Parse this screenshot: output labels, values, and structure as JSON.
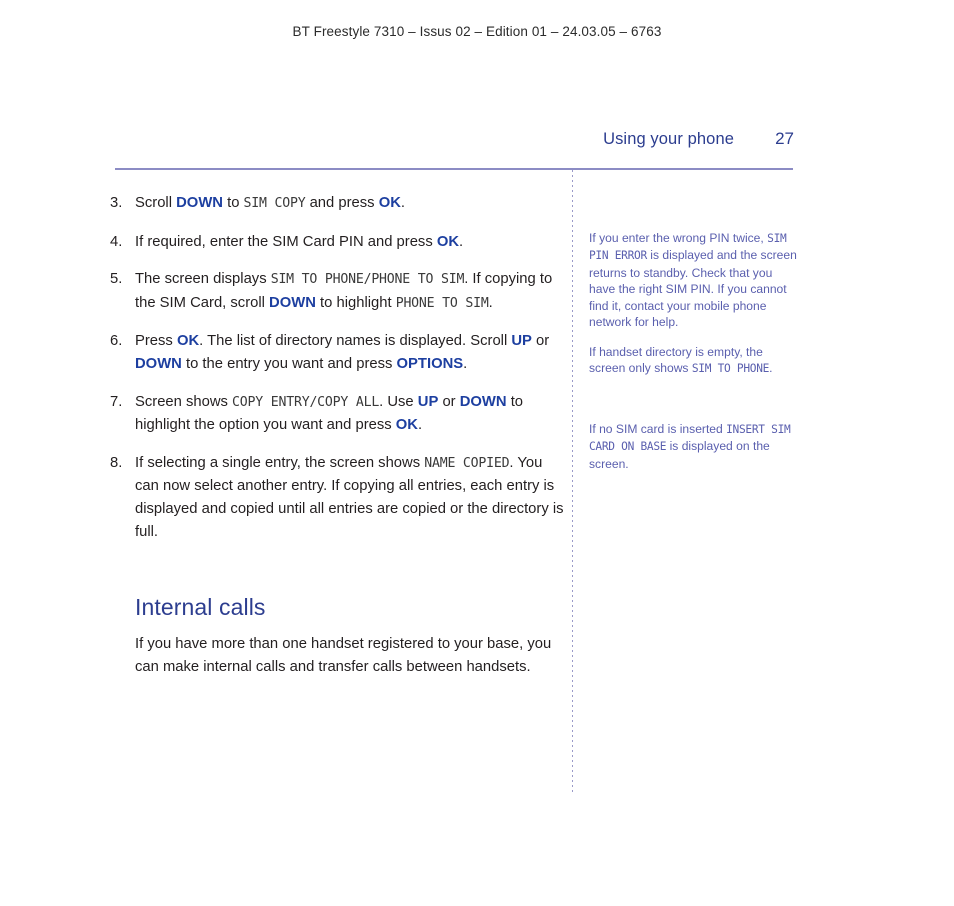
{
  "document_header": "BT Freestyle 7310 – Issus 02 – Edition 01 – 24.03.05 – 6763",
  "page_header": {
    "section_title": "Using your phone",
    "page_number": "27"
  },
  "steps": [
    {
      "number": "3.",
      "parts": [
        {
          "t": "Scroll ",
          "s": "plain"
        },
        {
          "t": "DOWN",
          "s": "kw"
        },
        {
          "t": " to ",
          "s": "plain"
        },
        {
          "t": "SIM COPY",
          "s": "lcd"
        },
        {
          "t": " and press ",
          "s": "plain"
        },
        {
          "t": "OK",
          "s": "kw"
        },
        {
          "t": ".",
          "s": "plain"
        }
      ]
    },
    {
      "number": "4.",
      "parts": [
        {
          "t": "If required, enter the SIM Card PIN and press ",
          "s": "plain"
        },
        {
          "t": "OK",
          "s": "kw"
        },
        {
          "t": ".",
          "s": "plain"
        }
      ]
    },
    {
      "number": "5.",
      "parts": [
        {
          "t": "The screen displays ",
          "s": "plain"
        },
        {
          "t": "SIM TO PHONE/PHONE TO SIM",
          "s": "lcd"
        },
        {
          "t": ". If copying to the SIM Card, scroll ",
          "s": "plain"
        },
        {
          "t": "DOWN",
          "s": "kw"
        },
        {
          "t": " to highlight ",
          "s": "plain"
        },
        {
          "t": "PHONE TO SIM",
          "s": "lcd"
        },
        {
          "t": ".",
          "s": "plain"
        }
      ]
    },
    {
      "number": "6.",
      "parts": [
        {
          "t": "Press ",
          "s": "plain"
        },
        {
          "t": "OK",
          "s": "kw"
        },
        {
          "t": ". The list of directory names is displayed. Scroll ",
          "s": "plain"
        },
        {
          "t": "UP",
          "s": "kw"
        },
        {
          "t": " or ",
          "s": "plain"
        },
        {
          "t": "DOWN",
          "s": "kw"
        },
        {
          "t": " to the entry you want and press ",
          "s": "plain"
        },
        {
          "t": "OPTIONS",
          "s": "kw"
        },
        {
          "t": ".",
          "s": "plain"
        }
      ]
    },
    {
      "number": "7.",
      "parts": [
        {
          "t": "Screen shows ",
          "s": "plain"
        },
        {
          "t": "COPY ENTRY/COPY ALL",
          "s": "lcd"
        },
        {
          "t": ". Use ",
          "s": "plain"
        },
        {
          "t": "UP",
          "s": "kw"
        },
        {
          "t": " or ",
          "s": "plain"
        },
        {
          "t": "DOWN",
          "s": "kw"
        },
        {
          "t": " to highlight the option you want and press ",
          "s": "plain"
        },
        {
          "t": "OK",
          "s": "kw"
        },
        {
          "t": ".",
          "s": "plain"
        }
      ]
    },
    {
      "number": "8.",
      "parts": [
        {
          "t": "If selecting a single entry, the screen shows ",
          "s": "plain"
        },
        {
          "t": "NAME COPIED",
          "s": "lcd"
        },
        {
          "t": ". You can now select another entry. If copying all entries, each entry is displayed and copied until all entries are copied or the directory is full.",
          "s": "plain"
        }
      ]
    }
  ],
  "subsection": {
    "heading": "Internal calls",
    "body": "If you have more than one handset registered to your base, you can make internal calls and transfer calls between handsets."
  },
  "side_notes": [
    {
      "parts": [
        {
          "t": "If you enter the wrong PIN twice, ",
          "s": "plain"
        },
        {
          "t": "SIM PIN ERROR",
          "s": "lcd"
        },
        {
          "t": " is displayed and the screen returns to standby. Check that you have the right SIM PIN. If you cannot find it, contact your mobile phone network for help.",
          "s": "plain"
        }
      ]
    },
    {
      "parts": [
        {
          "t": "If handset directory is empty, the screen only shows ",
          "s": "plain"
        },
        {
          "t": "SIM TO PHONE",
          "s": "lcd"
        },
        {
          "t": ".",
          "s": "plain"
        }
      ]
    },
    {
      "parts": [
        {
          "t": "If no SIM card is inserted ",
          "s": "plain"
        },
        {
          "t": "INSERT SIM CARD ON BASE",
          "s": "lcd"
        },
        {
          "t": " is displayed on the screen.",
          "s": "plain"
        }
      ]
    }
  ],
  "colors": {
    "keyword_blue": "#1d3fa0",
    "heading_blue": "#2c3d8f",
    "note_blue": "#5a5fae",
    "rule_purple": "#8c8cc4",
    "body_text": "#231f20"
  }
}
